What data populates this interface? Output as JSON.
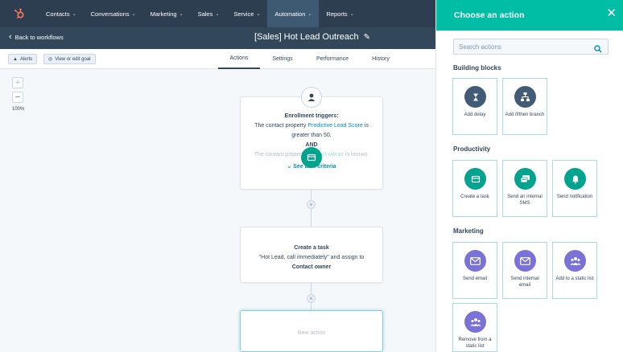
{
  "nav": {
    "logo_icon": "hubspot-sprocket-icon",
    "items": [
      {
        "label": "Contacts"
      },
      {
        "label": "Conversations"
      },
      {
        "label": "Marketing"
      },
      {
        "label": "Sales"
      },
      {
        "label": "Service"
      },
      {
        "label": "Automation"
      },
      {
        "label": "Reports"
      }
    ],
    "active": "Automation"
  },
  "header": {
    "back_label": "Back to workflows",
    "workflow_title": "[Sales] Hot Lead Outreach"
  },
  "subbar": {
    "alerts_label": "Alerts",
    "goal_label": "View or edit goal",
    "tabs": [
      {
        "label": "Actions"
      },
      {
        "label": "Settings"
      },
      {
        "label": "Performance"
      },
      {
        "label": "History"
      }
    ],
    "active_tab": "Actions"
  },
  "canvas": {
    "zoom_in": "+",
    "zoom_out": "−",
    "zoom_level": "100%",
    "enrollment": {
      "title": "Enrollment triggers:",
      "line1_pre": "The contact property",
      "line1_link": "Predictive Lead Score",
      "line1_post": "is",
      "line2": "greater than 50.",
      "and": "AND",
      "line3_pre": "The contact property",
      "line3_link": "Contact owner",
      "line3_post": "is known.",
      "see_all": "See all 4 criteria"
    },
    "task": {
      "title": "Create a task",
      "line1": "\"Hot Lead, call immediately\" and assign to",
      "line2": "Contact owner"
    },
    "new_action": "New action"
  },
  "panel": {
    "title": "Choose an action",
    "search_placeholder": "Search actions",
    "sections": [
      {
        "heading": "Building blocks",
        "items": [
          {
            "label": "Add delay",
            "icon": "hourglass-icon"
          },
          {
            "label": "Add if/then branch",
            "icon": "branch-icon"
          }
        ]
      },
      {
        "heading": "Productivity",
        "items": [
          {
            "label": "Create a task",
            "icon": "task-icon"
          },
          {
            "label": "Send an internal SMS",
            "icon": "sms-icon"
          },
          {
            "label": "Send notification",
            "icon": "bell-icon"
          }
        ]
      },
      {
        "heading": "Marketing",
        "items": [
          {
            "label": "Send email",
            "icon": "envelope-icon"
          },
          {
            "label": "Send internal email",
            "icon": "envelope-icon"
          },
          {
            "label": "Add to a static list",
            "icon": "people-icon"
          },
          {
            "label": "Remove from a static list",
            "icon": "people-icon"
          }
        ]
      }
    ]
  },
  "colors": {
    "nav_bg": "#2d3e50",
    "header_bg": "#33475b",
    "panel_header": "#00bda5",
    "building_blocks_icon": "#425b76",
    "productivity_icon": "#00a38d",
    "marketing_icon": "#7b72d8",
    "link": "#0091ae",
    "logo": "#ff7a59"
  }
}
